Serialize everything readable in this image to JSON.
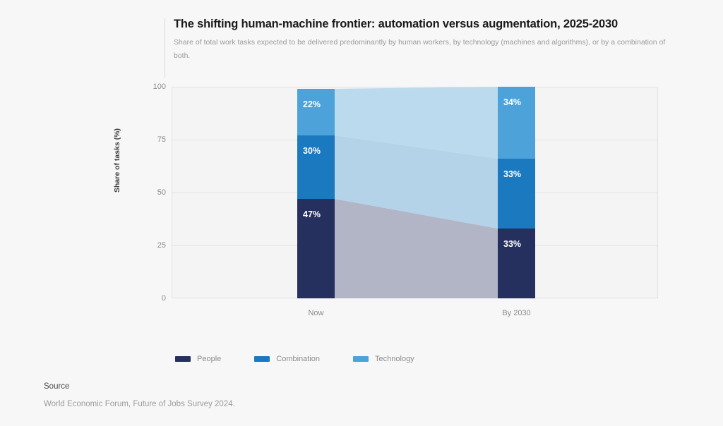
{
  "header": {
    "title": "The shifting human-machine frontier: automation versus augmentation, 2025-2030",
    "subtitle": "Share of total work tasks expected to be delivered predominantly by human workers, by technology (machines and algorithms), or by a combination of both."
  },
  "footer": {
    "heading": "Source",
    "text": "World Economic Forum, Future of Jobs Survey 2024."
  },
  "colors": {
    "people": "#26305e",
    "combination": "#1b79bf",
    "technology": "#4da3d9",
    "people_ribbon": "#b2b5c6",
    "combination_ribbon": "#b4d2e8",
    "technology_ribbon": "#bcdaee",
    "background": "#f7f7f7",
    "plot_background": "#f4f4f4",
    "gridline": "#e2e2e2",
    "title_text": "#1a1a1a",
    "muted_text": "#9b9b9b"
  },
  "chart_data": {
    "type": "bar",
    "subtype": "stacked-100-alluvial",
    "title": "The shifting human-machine frontier: automation versus augmentation, 2025-2030",
    "subtitle": "Share of total work tasks expected to be delivered predominantly by human workers, by technology (machines and algorithms), or by a combination of both.",
    "categories": [
      "Now",
      "By 2030"
    ],
    "xlabel": "",
    "ylabel": "Share of tasks (%)",
    "ylim": [
      0,
      100
    ],
    "yticks": [
      0,
      25,
      50,
      75,
      100
    ],
    "ytick_labels": [
      "0",
      "25",
      "50",
      "75",
      "100"
    ],
    "grid": true,
    "legend_position": "bottom-left",
    "stack_order_bottom_to_top": [
      "People",
      "Combination",
      "Technology"
    ],
    "series": [
      {
        "name": "People",
        "color": "#26305e",
        "values": [
          47,
          33
        ],
        "labels": [
          "47%",
          "33%"
        ]
      },
      {
        "name": "Combination",
        "color": "#1b79bf",
        "values": [
          30,
          33
        ],
        "labels": [
          "30%",
          "33%"
        ]
      },
      {
        "name": "Technology",
        "color": "#4da3d9",
        "values": [
          22,
          34
        ],
        "labels": [
          "22%",
          "34%"
        ]
      }
    ]
  }
}
